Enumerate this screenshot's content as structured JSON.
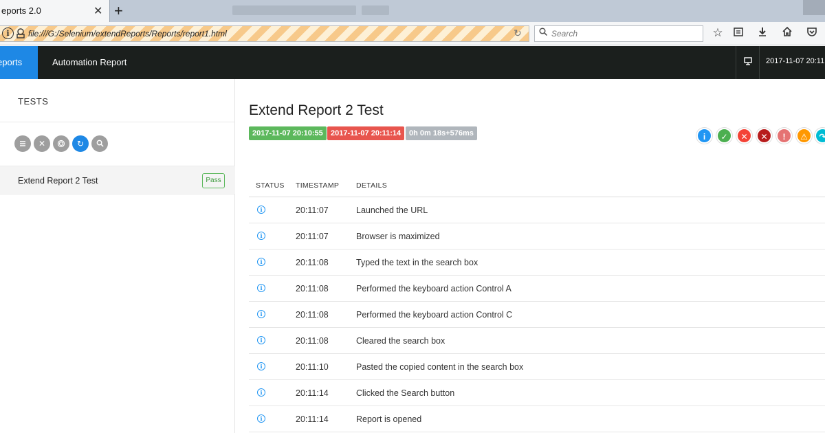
{
  "browser": {
    "tab_title": "eports 2.0",
    "tab_close": "✕",
    "new_tab": "+",
    "url": "file:///G:/Selenium/extendReports/Reports/report1.html",
    "search_placeholder": "Search"
  },
  "header": {
    "brand": "eports",
    "title": "Automation Report",
    "datetime": "2017-11-07 20:11:"
  },
  "left_panel": {
    "heading": "TESTS",
    "filters": [
      "list-icon",
      "close-icon",
      "fingerprint-icon",
      "refresh-icon",
      "search-icon"
    ],
    "tests": [
      {
        "name": "Extend Report 2 Test",
        "status": "Pass"
      }
    ]
  },
  "detail": {
    "title": "Extend Report 2 Test",
    "start_time": "2017-11-07 20:10:55",
    "end_time": "2017-11-07 20:11:14",
    "duration": "0h 0m 18s+576ms",
    "status_icons": [
      {
        "name": "info-icon",
        "color": "#2196f3"
      },
      {
        "name": "pass-icon",
        "color": "#4caf50"
      },
      {
        "name": "fail-icon",
        "color": "#f44336"
      },
      {
        "name": "fatal-icon",
        "color": "#b71c1c"
      },
      {
        "name": "error-icon",
        "color": "#e57373"
      },
      {
        "name": "warning-icon",
        "color": "#ff9800"
      },
      {
        "name": "skip-icon",
        "color": "#00bcd4"
      }
    ],
    "columns": {
      "status": "STATUS",
      "timestamp": "TIMESTAMP",
      "details": "DETAILS"
    },
    "logs": [
      {
        "time": "20:11:07",
        "details": "Launched the URL"
      },
      {
        "time": "20:11:07",
        "details": "Browser is maximized"
      },
      {
        "time": "20:11:08",
        "details": "Typed the text in the search box"
      },
      {
        "time": "20:11:08",
        "details": "Performed the keyboard action Control A"
      },
      {
        "time": "20:11:08",
        "details": "Performed the keyboard action Control C"
      },
      {
        "time": "20:11:08",
        "details": "Cleared the search box"
      },
      {
        "time": "20:11:10",
        "details": "Pasted the copied content in the search box"
      },
      {
        "time": "20:11:14",
        "details": "Clicked the Search button"
      },
      {
        "time": "20:11:14",
        "details": "Report is opened"
      }
    ]
  }
}
